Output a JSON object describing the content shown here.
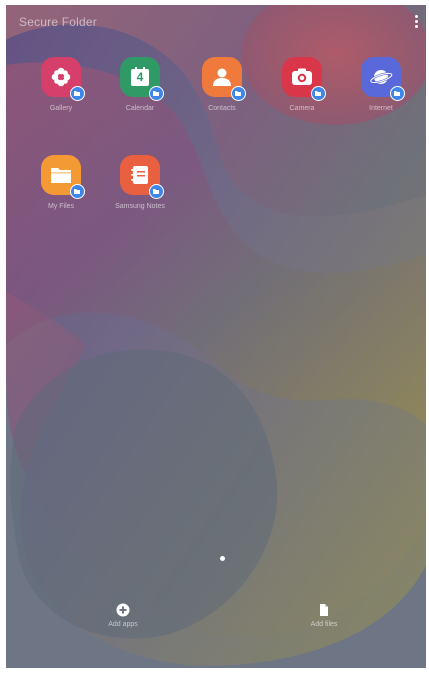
{
  "header": {
    "title": "Secure Folder"
  },
  "apps": [
    {
      "label": "Gallery",
      "color": "#d53f6a",
      "icon": "gallery-flower-icon"
    },
    {
      "label": "Calendar",
      "color": "#2f9a66",
      "icon": "calendar-icon",
      "day": "4"
    },
    {
      "label": "Contacts",
      "color": "#f07a3b",
      "icon": "contacts-person-icon"
    },
    {
      "label": "Camera",
      "color": "#d9364a",
      "icon": "camera-icon"
    },
    {
      "label": "Internet",
      "color": "#5a69d9",
      "icon": "internet-planet-icon"
    },
    {
      "label": "My Files",
      "color": "#f39a34",
      "icon": "folder-icon"
    },
    {
      "label": "Samsung Notes",
      "color": "#e8603f",
      "icon": "notes-icon"
    }
  ],
  "page_indicator": {
    "current": 1,
    "total": 1
  },
  "actions": {
    "add_apps": "Add apps",
    "add_files": "Add files"
  },
  "colors": {
    "badge": "#3f86ea"
  }
}
